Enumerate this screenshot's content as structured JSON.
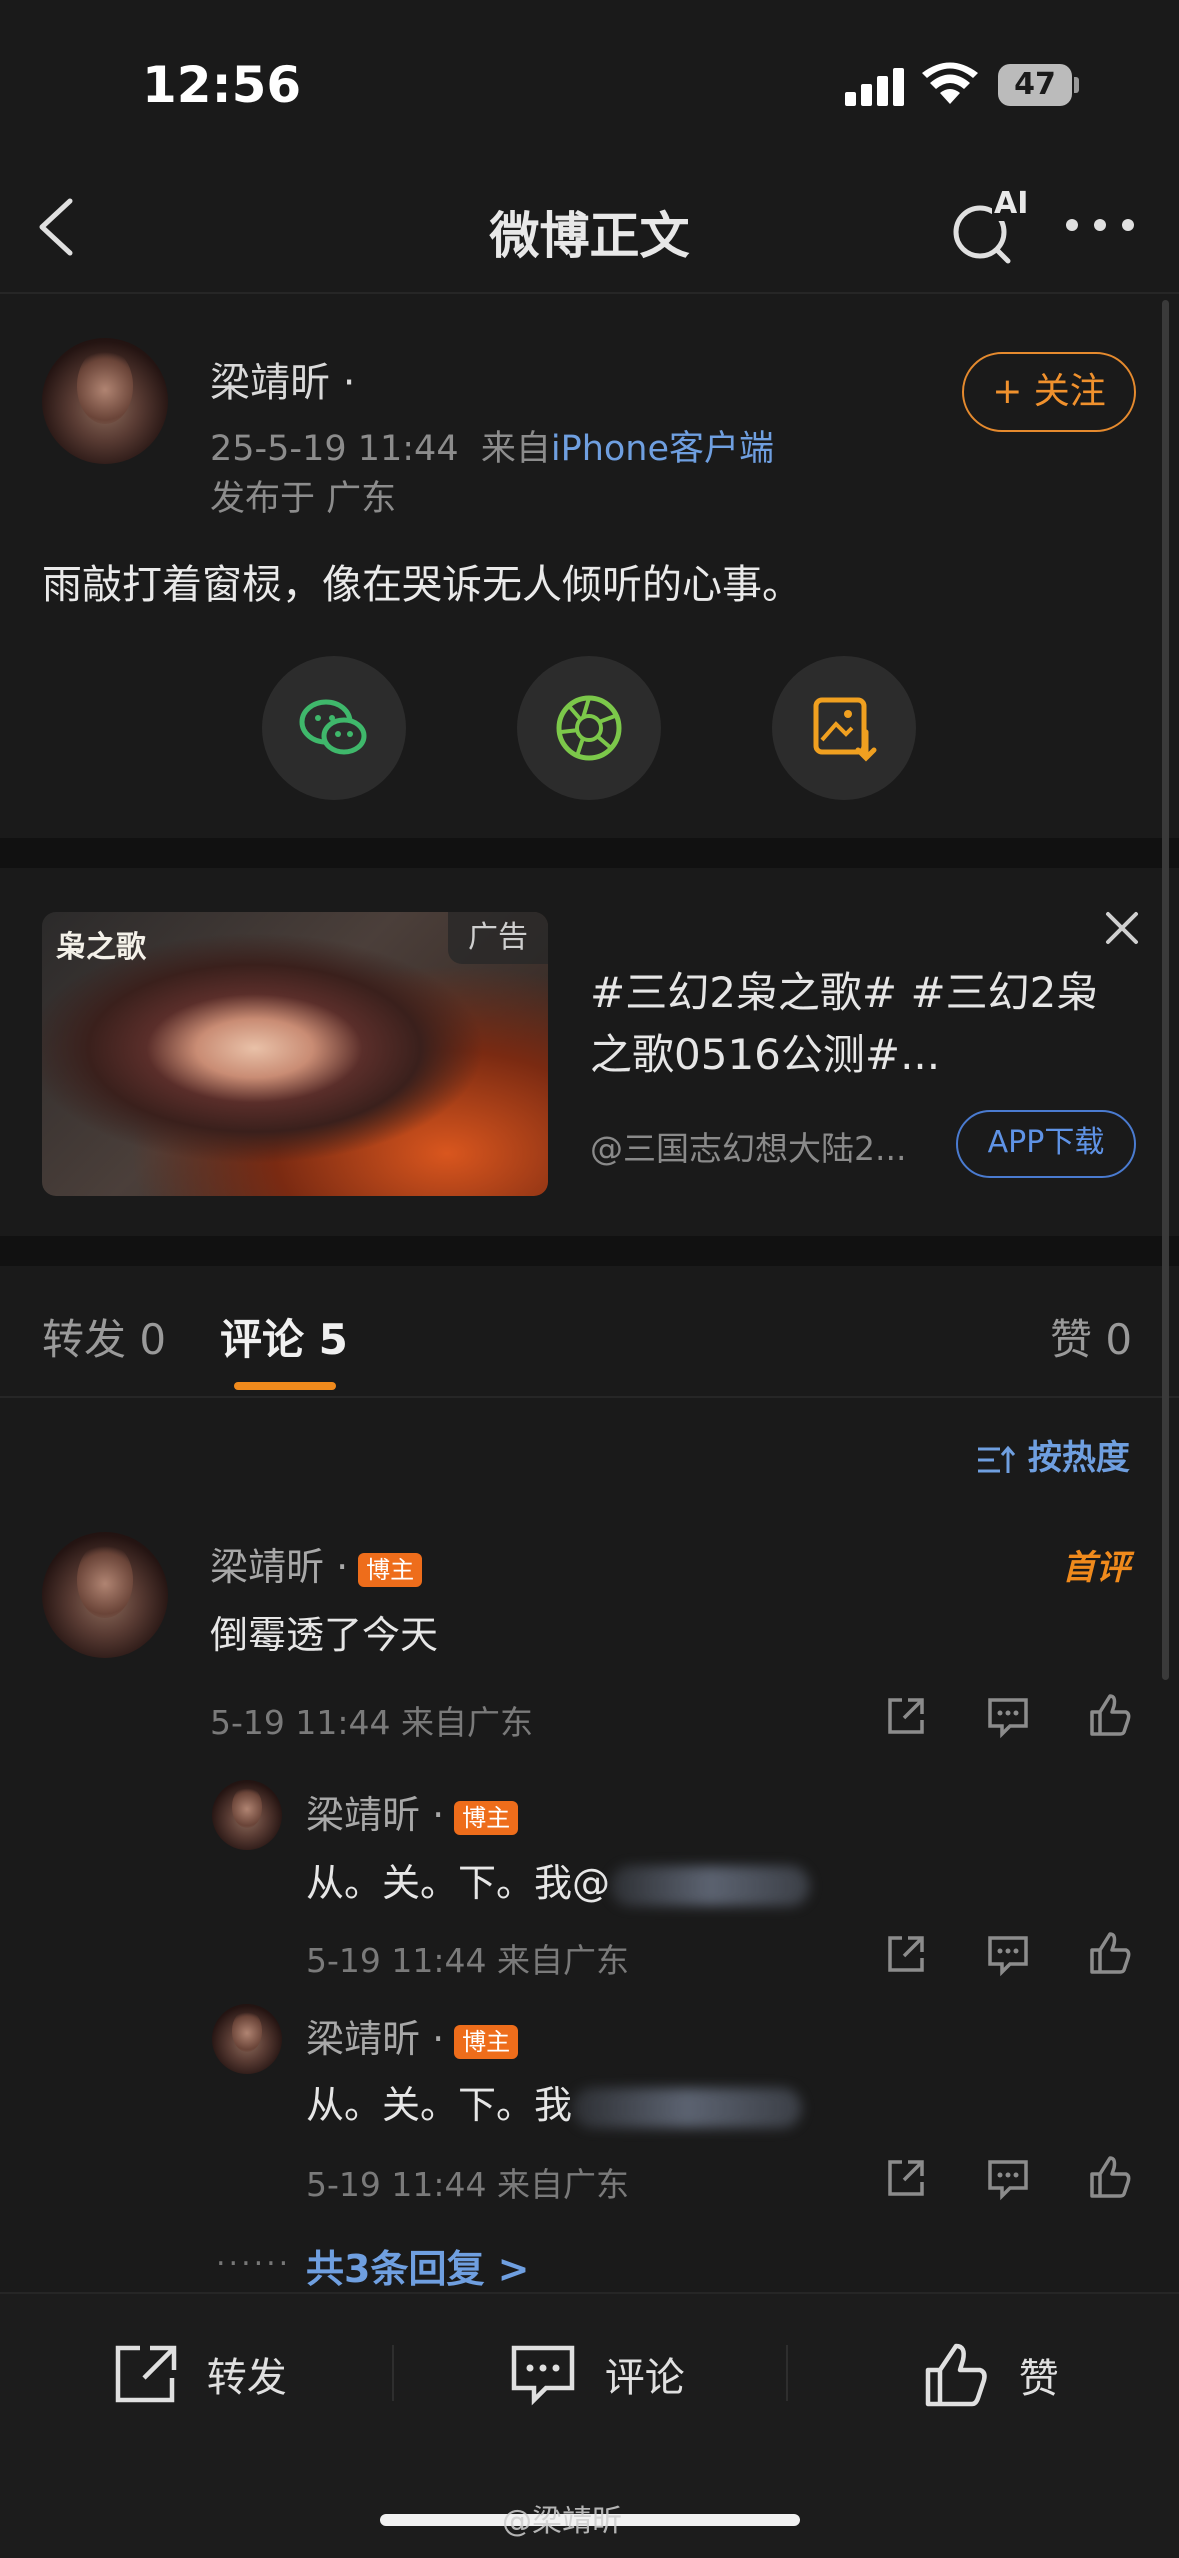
{
  "status": {
    "time": "12:56",
    "battery": "47"
  },
  "nav": {
    "title": "微博正文",
    "ai_label": "AI"
  },
  "post": {
    "author": "梁靖昕 ·",
    "time": "25-5-19 11:44",
    "from_prefix": "来自",
    "source": "iPhone客户端",
    "location": "发布于 广东",
    "follow_label": "+ 关注",
    "text": "雨敲打着窗棂，像在哭诉无人倾听的心事。"
  },
  "ad": {
    "tag": "广告",
    "logo": "枭之歌",
    "title": "#三幻2枭之歌# #三幻2枭之歌0516公测#...",
    "source": "@三国志幻想大陆2...",
    "button": "APP下载"
  },
  "tabs": {
    "repost": "转发 0",
    "comment": "评论 5",
    "like": "赞 0"
  },
  "sort_label": "按热度",
  "comments": [
    {
      "name": "梁靖昕 ·",
      "badge": "博主",
      "text": "倒霉透了今天",
      "meta": "5-19 11:44  来自广东",
      "first_tag": "首评"
    },
    {
      "name": "梁靖昕 ·",
      "badge": "博主",
      "text": "从。关。下。我@",
      "meta": "5-19 11:44  来自广东"
    },
    {
      "name": "梁靖昕 ·",
      "badge": "博主",
      "text": "从。关。下。我",
      "meta": "5-19 11:44  来自广东"
    }
  ],
  "more_replies": "共3条回复 >",
  "more_dots": "......",
  "bottom": {
    "repost": "转发",
    "comment": "评论",
    "like": "赞"
  },
  "watermark": "@梁靖昕"
}
